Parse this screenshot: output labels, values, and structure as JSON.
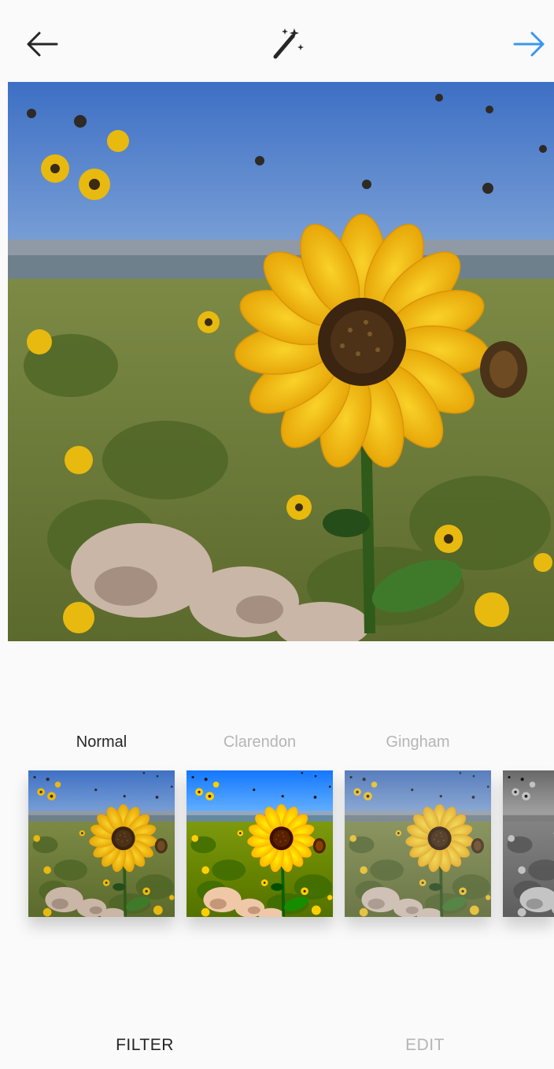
{
  "header": {
    "back_icon": "arrow-left-icon",
    "magic_icon": "magic-wand-icon",
    "next_icon": "arrow-right-icon",
    "next_color": "#3897f0"
  },
  "preview": {
    "description_icon": "photo-sunflower"
  },
  "filters": [
    {
      "label": "Normal",
      "selected": true
    },
    {
      "label": "Clarendon",
      "selected": false
    },
    {
      "label": "Gingham",
      "selected": false
    },
    {
      "label": "",
      "selected": false
    }
  ],
  "tabs": {
    "filter": "FILTER",
    "edit": "EDIT"
  },
  "colors": {
    "background": "#fafafa",
    "active_text": "#262626",
    "inactive_text": "#b5b5b5"
  }
}
